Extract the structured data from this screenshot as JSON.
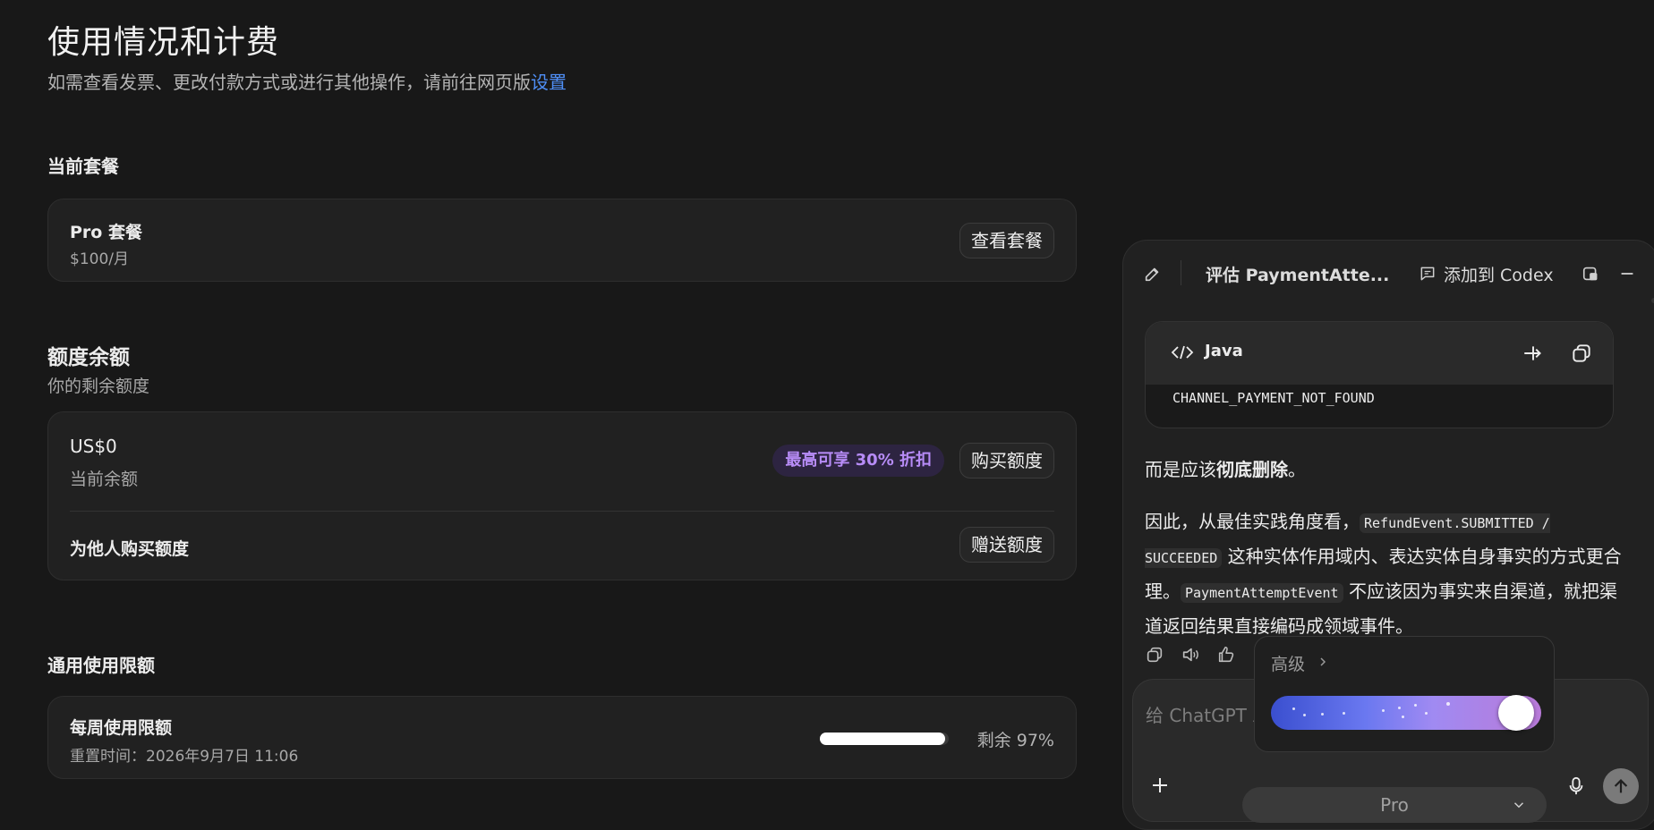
{
  "page": {
    "title": "使用情况和计费",
    "subtitle_text": "如需查看发票、更改付款方式或进行其他操作，请前往网页版",
    "subtitle_link": "设置"
  },
  "current_plan": {
    "heading": "当前套餐",
    "plan_name": "Pro 套餐",
    "plan_price": "$100/月",
    "view_button": "查看套餐"
  },
  "credits": {
    "heading": "额度余额",
    "subheading": "你的剩余额度",
    "balance": "US$0",
    "balance_label": "当前余额",
    "promo_badge": "最高可享 30% 折扣",
    "buy_button": "购买额度",
    "gift_label": "为他人购买额度",
    "gift_button": "赠送额度"
  },
  "usage_limits": {
    "heading": "通用使用限额",
    "weekly_title": "每周使用限额",
    "weekly_reset": "重置时间：2026年9月7日 11:06",
    "remaining_text": "剩余 97%",
    "remaining_fraction": 0.97
  },
  "chat": {
    "title": "评估 PaymentAtte...",
    "add_to_codex": "添加到 Codex",
    "code_language": "Java",
    "code_line": "CHANNEL_PAYMENT_NOT_FOUND",
    "para1_prefix": "而是应该",
    "para1_bold": "彻底删除",
    "para1_suffix": "。",
    "para2_a": "因此，从最佳实践角度看，",
    "para2_code1": "RefundEvent.SUBMITTED / SUCCEEDED",
    "para2_b": " 这种实体作用域内、表达实体自身事实的方式更合理。",
    "para2_code2": "PaymentAttemptEvent",
    "para2_c": " 不应该因为事实来自渠道，就把渠道返回结果直接编码成领域事件。",
    "composer_placeholder": "给 ChatGPT 发",
    "popup_label": "高级",
    "model_select": "Pro"
  },
  "colors": {
    "background": "#181818",
    "card": "#212121",
    "link": "#4f8ff7",
    "promo_text": "#b78cf7",
    "promo_bg": "#2d2441"
  },
  "icons": [
    "edit-icon",
    "comment-icon",
    "popout-icon",
    "minimize-icon",
    "code-icon",
    "wrap-icon",
    "copy-icon",
    "speaker-icon",
    "thumbs-up-icon",
    "chevron-right-icon",
    "plus-icon",
    "chevron-down-icon",
    "mic-icon",
    "send-arrow-icon"
  ]
}
